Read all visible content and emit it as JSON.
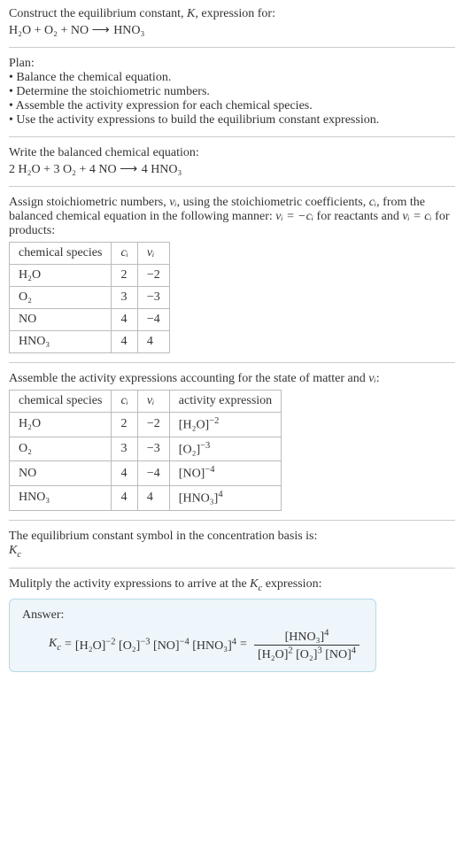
{
  "prompt": {
    "line1": "Construct the equilibrium constant, ",
    "K": "K",
    "line1b": ", expression for:",
    "equation_lhs": "H₂O + O₂ + NO",
    "arrow": "⟶",
    "equation_rhs": "HNO₃"
  },
  "plan": {
    "heading": "Plan:",
    "items": [
      "Balance the chemical equation.",
      "Determine the stoichiometric numbers.",
      "Assemble the activity expression for each chemical species.",
      "Use the activity expressions to build the equilibrium constant expression."
    ]
  },
  "balanced": {
    "heading": "Write the balanced chemical equation:",
    "lhs": "2 H₂O + 3 O₂ + 4 NO",
    "arrow": "⟶",
    "rhs": "4 HNO₃"
  },
  "stoich": {
    "text_a": "Assign stoichiometric numbers, ",
    "nu": "νᵢ",
    "text_b": ", using the stoichiometric coefficients, ",
    "ci": "cᵢ",
    "text_c": ", from the balanced chemical equation in the following manner: ",
    "rel_react": "νᵢ = −cᵢ",
    "text_d": " for reactants and ",
    "rel_prod": "νᵢ = cᵢ",
    "text_e": " for products:",
    "headers": {
      "species": "chemical species",
      "ci": "cᵢ",
      "nu": "νᵢ"
    },
    "rows": [
      {
        "species": "H₂O",
        "ci": "2",
        "nu": "−2"
      },
      {
        "species": "O₂",
        "ci": "3",
        "nu": "−3"
      },
      {
        "species": "NO",
        "ci": "4",
        "nu": "−4"
      },
      {
        "species": "HNO₃",
        "ci": "4",
        "nu": "4"
      }
    ]
  },
  "activity": {
    "heading_a": "Assemble the activity expressions accounting for the state of matter and ",
    "nu": "νᵢ",
    "heading_b": ":",
    "headers": {
      "species": "chemical species",
      "ci": "cᵢ",
      "nu": "νᵢ",
      "act": "activity expression"
    },
    "rows": [
      {
        "species": "H₂O",
        "ci": "2",
        "nu": "−2",
        "base": "[H₂O]",
        "exp": "−2"
      },
      {
        "species": "O₂",
        "ci": "3",
        "nu": "−3",
        "base": "[O₂]",
        "exp": "−3"
      },
      {
        "species": "NO",
        "ci": "4",
        "nu": "−4",
        "base": "[NO]",
        "exp": "−4"
      },
      {
        "species": "HNO₃",
        "ci": "4",
        "nu": "4",
        "base": "[HNO₃]",
        "exp": "4"
      }
    ]
  },
  "kc_symbol": {
    "line1": "The equilibrium constant symbol in the concentration basis is:",
    "symbol": "K",
    "sub": "c"
  },
  "multiply": {
    "line_a": "Mulitply the activity expressions to arrive at the ",
    "kc": "K",
    "kc_sub": "c",
    "line_b": " expression:"
  },
  "answer": {
    "label": "Answer:",
    "kc": "K",
    "kc_sub": "c",
    "eq": " = ",
    "terms": [
      {
        "base": "[H₂O]",
        "exp": "−2"
      },
      {
        "base": "[O₂]",
        "exp": "−3"
      },
      {
        "base": "[NO]",
        "exp": "−4"
      },
      {
        "base": "[HNO₃]",
        "exp": "4"
      }
    ],
    "eq2": " = ",
    "num": [
      {
        "base": "[HNO₃]",
        "exp": "4"
      }
    ],
    "den": [
      {
        "base": "[H₂O]",
        "exp": "2"
      },
      {
        "base": "[O₂]",
        "exp": "3"
      },
      {
        "base": "[NO]",
        "exp": "4"
      }
    ]
  }
}
